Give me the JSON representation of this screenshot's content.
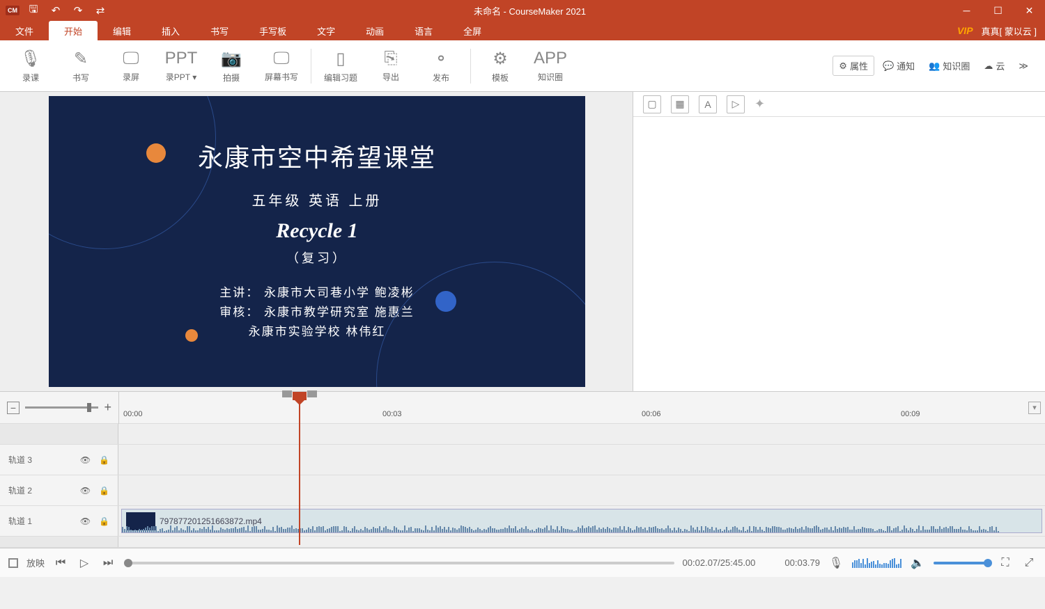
{
  "title": "未命名 - CourseMaker 2021",
  "window": {
    "user_label": "真真[ 蒙以云 ]",
    "vip": "VIP"
  },
  "menu": [
    "文件",
    "开始",
    "编辑",
    "插入",
    "书写",
    "手写板",
    "文字",
    "动画",
    "语言",
    "全屏"
  ],
  "menu_active": 1,
  "ribbon": [
    {
      "icon": "🎙",
      "label": "录课"
    },
    {
      "icon": "✎",
      "label": "书写"
    },
    {
      "icon": "🖵",
      "label": "录屏"
    },
    {
      "icon": "PPT",
      "label": "录PPT",
      "dropdown": true
    },
    {
      "icon": "📷",
      "label": "拍摄"
    },
    {
      "icon": "🖵",
      "label": "屏幕书写"
    },
    {
      "icon": "▯",
      "label": "编辑习题"
    },
    {
      "icon": "⎘",
      "label": "导出"
    },
    {
      "icon": "⚬",
      "label": "发布"
    },
    {
      "icon": "⚙",
      "label": "模板"
    },
    {
      "icon": "APP",
      "label": "知识圈"
    }
  ],
  "ribbon_right": [
    {
      "icon": "⚙",
      "label": "属性",
      "active": true
    },
    {
      "icon": "💬",
      "label": "通知"
    },
    {
      "icon": "👥",
      "label": "知识圈"
    },
    {
      "icon": "☁",
      "label": "云"
    }
  ],
  "slide": {
    "title": "永康市空中希望课堂",
    "line1": "五年级  英语  上册",
    "line2": "Recycle 1",
    "line3": "（复习）",
    "credits_l1": "主讲：  永康市大司巷小学      鲍凌彬",
    "credits_l2": "审核：  永康市教学研究室      施惠兰",
    "credits_l3": "            永康市实验学校          林伟红"
  },
  "ruler": [
    "00:00",
    "00:03",
    "00:06",
    "00:09"
  ],
  "tracks": [
    {
      "label": "轨道 3"
    },
    {
      "label": "轨道 2"
    },
    {
      "label": "轨道 1",
      "clip": "797877201251663872.mp4"
    }
  ],
  "playback": {
    "play_label": "放映",
    "time_current": "00:02.07",
    "time_total": "25:45.00",
    "time_marker": "00:03.79"
  }
}
